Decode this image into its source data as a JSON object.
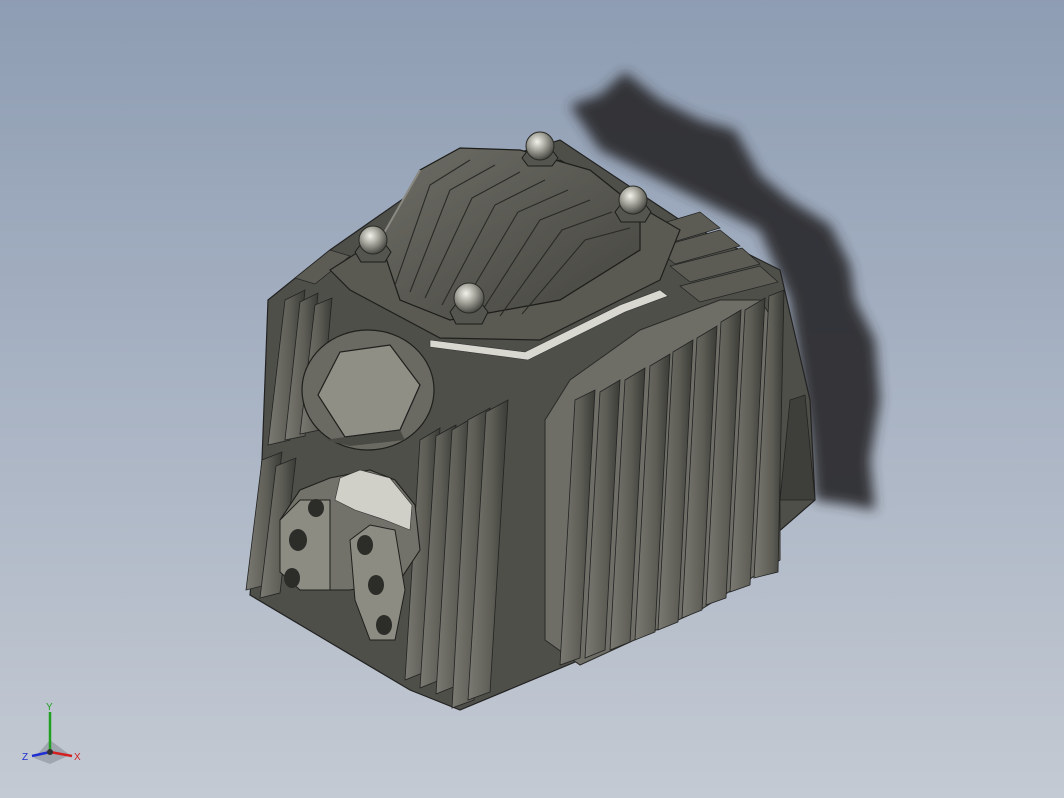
{
  "viewport": {
    "background_top": "#8e9db3",
    "background_bottom": "#c4cad3"
  },
  "model": {
    "name_icon": "engine-cylinder-head-model",
    "body_color": "#5f5f5a",
    "fin_color": "#6b6b63",
    "fin_dark": "#3a3a36",
    "cap_color": "#a9a9a0",
    "shadow_color": "#2d2f33"
  },
  "triad": {
    "x_label": "X",
    "y_label": "Y",
    "z_label": "Z",
    "x_color": "#d42020",
    "y_color": "#20a020",
    "z_color": "#2030d0"
  }
}
